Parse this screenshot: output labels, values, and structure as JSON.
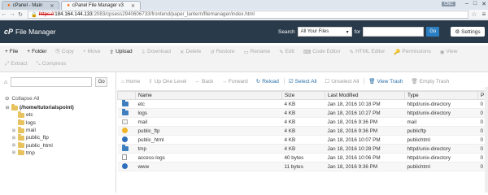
{
  "browser": {
    "tabs": [
      {
        "label": "cPanel - Main"
      },
      {
        "label": "cPanel File Manager v3"
      }
    ],
    "user_badge": "CNC",
    "url": {
      "scheme": "https://",
      "host": "184.164.144.133",
      "path": ":2083/cpsess2940606733/frontend/paper_lantern/filemanager/index.html"
    }
  },
  "header": {
    "logo": "cP",
    "title": "File Manager",
    "search_label": "Search",
    "search_scope": "All Your Files",
    "for_label": "for",
    "go_label": "Go",
    "settings_label": "Settings"
  },
  "toolbar": {
    "row1": [
      {
        "icon": "+",
        "label": "File",
        "enabled": true
      },
      {
        "icon": "+",
        "label": "Folder",
        "enabled": true
      },
      {
        "icon": "⎘",
        "label": "Copy",
        "enabled": false
      },
      {
        "icon": "+",
        "label": "Move",
        "enabled": false
      },
      {
        "icon": "⇧",
        "label": "Upload",
        "enabled": true
      },
      {
        "icon": "⇩",
        "label": "Download",
        "enabled": false
      },
      {
        "icon": "✕",
        "label": "Delete",
        "enabled": false
      },
      {
        "icon": "↺",
        "label": "Restore",
        "enabled": false
      },
      {
        "icon": "▭",
        "label": "Rename",
        "enabled": false
      },
      {
        "icon": "✎",
        "label": "Edit",
        "enabled": false
      },
      {
        "icon": "⌨",
        "label": "Code Editor",
        "enabled": false
      },
      {
        "icon": "✎",
        "label": "HTML Editor",
        "enabled": false
      },
      {
        "icon": "🔑",
        "label": "Permissions",
        "enabled": false
      },
      {
        "icon": "◉",
        "label": "View",
        "enabled": false
      }
    ],
    "row2": [
      {
        "icon": "⤢",
        "label": "Extract",
        "enabled": false
      },
      {
        "icon": "⤡",
        "label": "Compress",
        "enabled": false
      }
    ]
  },
  "tree": {
    "go_label": "Go",
    "collapse_all": "Collapse All",
    "root": "(/home/tutorialspoint)",
    "children": [
      {
        "name": "etc",
        "expandable": false
      },
      {
        "name": "logs",
        "expandable": false
      },
      {
        "name": "mail",
        "expandable": true
      },
      {
        "name": "public_ftp",
        "expandable": true
      },
      {
        "name": "public_html",
        "expandable": true
      },
      {
        "name": "tmp",
        "expandable": true
      }
    ]
  },
  "navbar": [
    {
      "icon": "⌂",
      "label": "Home",
      "enabled": false
    },
    {
      "icon": "⇧",
      "label": "Up One Level",
      "enabled": false
    },
    {
      "icon": "←",
      "label": "Back",
      "enabled": false
    },
    {
      "icon": "→",
      "label": "Forward",
      "enabled": false
    },
    {
      "icon": "↻",
      "label": "Reload",
      "enabled": true
    },
    {
      "icon": "☑",
      "label": "Select All",
      "enabled": true
    },
    {
      "icon": "☐",
      "label": "Unselect All",
      "enabled": false
    },
    {
      "icon": "🗑",
      "label": "View Trash",
      "enabled": true
    },
    {
      "icon": "🗑",
      "label": "Empty Trash",
      "enabled": false
    }
  ],
  "table": {
    "columns": [
      "Name",
      "Size",
      "Last Modified",
      "Type",
      "P"
    ],
    "rows": [
      {
        "icon": "folder",
        "name": "etc",
        "size": "4 KB",
        "modified": "Jan 18, 2016 10:18 PM",
        "type": "httpd/unix-directory",
        "perm": "0"
      },
      {
        "icon": "folder",
        "name": "logs",
        "size": "4 KB",
        "modified": "Jan 18, 2016 10:27 PM",
        "type": "httpd/unix-directory",
        "perm": "0"
      },
      {
        "icon": "mail",
        "name": "mail",
        "size": "4 KB",
        "modified": "Jan 18, 2016 9:36 PM",
        "type": "mail",
        "perm": "0"
      },
      {
        "icon": "warn",
        "name": "public_ftp",
        "size": "4 KB",
        "modified": "Jan 18, 2016 9:36 PM",
        "type": "publicftp",
        "perm": "0"
      },
      {
        "icon": "globe",
        "name": "public_html",
        "size": "4 KB",
        "modified": "Jan 18, 2016 10:07 PM",
        "type": "publichtml",
        "perm": "0"
      },
      {
        "icon": "folder",
        "name": "tmp",
        "size": "4 KB",
        "modified": "Jan 18, 2016 10:28 PM",
        "type": "httpd/unix-directory",
        "perm": "0"
      },
      {
        "icon": "text",
        "name": "access-logs",
        "size": "40 bytes",
        "modified": "Jan 18, 2016 10:06 PM",
        "type": "httpd/unix-directory",
        "perm": "0"
      },
      {
        "icon": "globe",
        "name": "www",
        "size": "11 bytes",
        "modified": "Jan 18, 2016 9:36 PM",
        "type": "publichtml",
        "perm": "0"
      }
    ]
  }
}
